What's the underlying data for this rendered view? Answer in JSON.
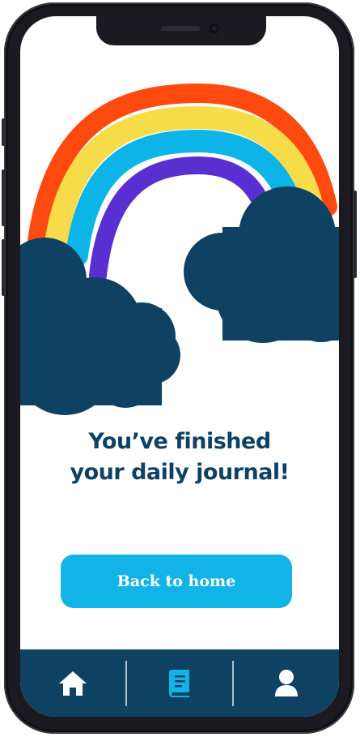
{
  "screen": {
    "title_line1": "You’ve finished",
    "title_line2": "your daily journal!",
    "primary_button_label": "Back to home"
  },
  "illustration": {
    "name": "rainbow-with-clouds",
    "colors": {
      "red": "#ff4a0f",
      "yellow": "#f7dc4a",
      "blue": "#0db4e8",
      "purple": "#5a2fd1",
      "cloud": "#0f4162"
    }
  },
  "navbar": {
    "items": [
      {
        "icon": "home-icon",
        "active": false
      },
      {
        "icon": "journal-icon",
        "active": true
      },
      {
        "icon": "profile-icon",
        "active": false
      }
    ],
    "colors": {
      "background": "#0f4162",
      "icon": "#ffffff",
      "active_icon": "#12b3e6"
    }
  },
  "theme": {
    "heading_color": "#0f4162",
    "button_color": "#12b3e6",
    "button_text_color": "#ffffff",
    "background": "#ffffff"
  }
}
